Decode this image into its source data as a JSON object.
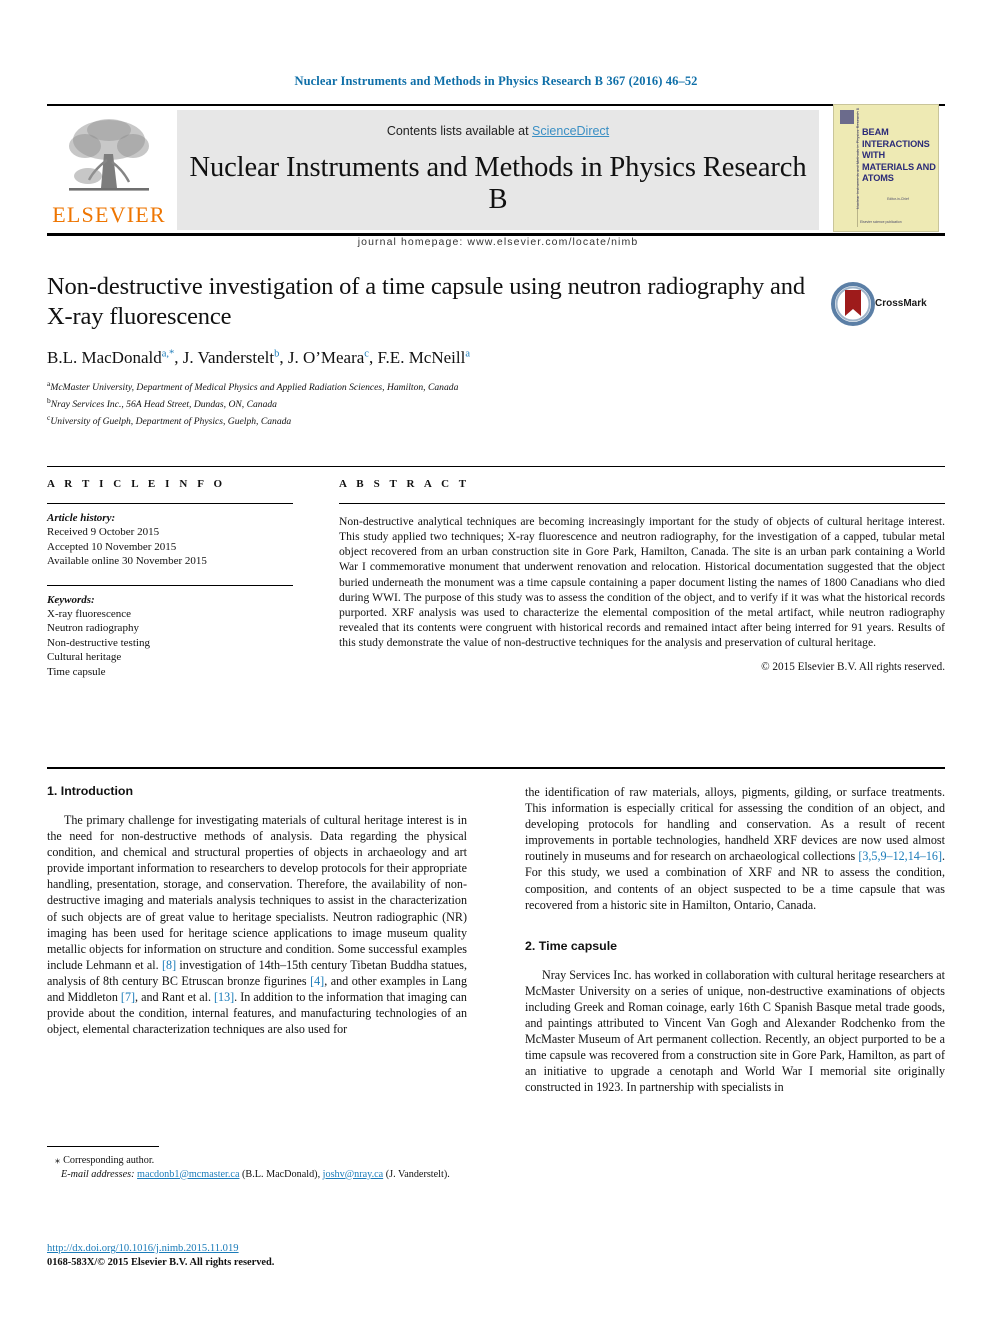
{
  "running_head": "Nuclear Instruments and Methods in Physics Research B 367 (2016) 46–52",
  "masthead": {
    "contents_prefix": "Contents lists available at ",
    "sciencedirect": "ScienceDirect",
    "journal_title": "Nuclear Instruments and Methods in Physics Research B",
    "homepage": "journal homepage: www.elsevier.com/locate/nimb",
    "publisher_logo_text": "ELSEVIER",
    "cover": {
      "heading": "BEAM INTERACTIONS WITH MATERIALS AND ATOMS",
      "spine": "Nuclear Instruments and Methods in Physics Research B",
      "subtitle": "Editor-in-Chief",
      "footer": "Elsevier science publication"
    },
    "colors": {
      "link": "#3a8fc4",
      "banner_bg": "#e7e7e7",
      "elsevier_orange": "#ee7501",
      "cover_bg": "#eeeab4",
      "cover_text": "#2b2b78"
    }
  },
  "article": {
    "title": "Non-destructive investigation of a time capsule using neutron radiography and X-ray fluorescence",
    "authors": [
      {
        "name": "B.L. MacDonald",
        "marks": "a,*"
      },
      {
        "name": "J. Vanderstelt",
        "marks": "b"
      },
      {
        "name": "J. O’Meara",
        "marks": "c"
      },
      {
        "name": "F.E. McNeill",
        "marks": "a"
      }
    ],
    "affiliations": [
      {
        "label": "a",
        "text": "McMaster University, Department of Medical Physics and Applied Radiation Sciences, Hamilton, Canada"
      },
      {
        "label": "b",
        "text": "Nray Services Inc., 56A Head Street, Dundas, ON, Canada"
      },
      {
        "label": "c",
        "text": "University of Guelph, Department of Physics, Guelph, Canada"
      }
    ],
    "crossmark_label": "CrossMark"
  },
  "article_info": {
    "heading": "A R T I C L E    I N F O",
    "history_label": "Article history:",
    "history": [
      "Received 9 October 2015",
      "Accepted 10 November 2015",
      "Available online 30 November 2015"
    ],
    "keywords_label": "Keywords:",
    "keywords": [
      "X-ray fluorescence",
      "Neutron radiography",
      "Non-destructive testing",
      "Cultural heritage",
      "Time capsule"
    ]
  },
  "abstract": {
    "heading": "A B S T R A C T",
    "text": "Non-destructive analytical techniques are becoming increasingly important for the study of objects of cultural heritage interest. This study applied two techniques; X-ray fluorescence and neutron radiography, for the investigation of a capped, tubular metal object recovered from an urban construction site in Gore Park, Hamilton, Canada. The site is an urban park containing a World War I commemorative monument that underwent renovation and relocation. Historical documentation suggested that the object buried underneath the monument was a time capsule containing a paper document listing the names of 1800 Canadians who died during WWI. The purpose of this study was to assess the condition of the object, and to verify if it was what the historical records purported. XRF analysis was used to characterize the elemental composition of the metal artifact, while neutron radiography revealed that its contents were congruent with historical records and remained intact after being interred for 91 years. Results of this study demonstrate the value of non-destructive techniques for the analysis and preservation of cultural heritage.",
    "copyright": "© 2015 Elsevier B.V. All rights reserved."
  },
  "sections": {
    "introduction_heading": "1. Introduction",
    "introduction_para_left_a": "The primary challenge for investigating materials of cultural heritage interest is in the need for non-destructive methods of analysis. Data regarding the physical condition, and chemical and structural properties of objects in archaeology and art provide important information to researchers to develop protocols for their appropriate handling, presentation, storage, and conservation. Therefore, the availability of non-destructive imaging and materials analysis techniques to assist in the characterization of such objects are of great value to heritage specialists. Neutron radiographic (NR) imaging has been used for heritage science applications to image museum quality metallic objects for information on structure and condition. Some successful examples include Lehmann et al. ",
    "ref_8": "[8]",
    "introduction_para_left_b": " investigation of 14th–15th century Tibetan Buddha statues, analysis of 8th century BC Etruscan bronze figurines ",
    "ref_4": "[4]",
    "introduction_para_left_c": ", and other examples in Lang and Middleton ",
    "ref_7": "[7]",
    "introduction_para_left_d": ", and Rant et al. ",
    "ref_13": "[13]",
    "introduction_para_left_e": ". In addition to the information that imaging can provide about the condition, internal features, and manufacturing technologies of an object, elemental characterization techniques are also used for",
    "introduction_para_right_a": "the identification of raw materials, alloys, pigments, gilding, or surface treatments. This information is especially critical for assessing the condition of an object, and developing protocols for handling and conservation. As a result of recent improvements in portable technologies, handheld XRF devices are now used almost routinely in museums and for research on archaeological collections ",
    "ref_group": "[3,5,9–12,14–16]",
    "introduction_para_right_b": ". For this study, we used a combination of XRF and NR to assess the condition, composition, and contents of an object suspected to be a time capsule that was recovered from a historic site in Hamilton, Ontario, Canada.",
    "time_capsule_heading": "2. Time capsule",
    "time_capsule_para": "Nray Services Inc. has worked in collaboration with cultural heritage researchers at McMaster University on a series of unique, non-destructive examinations of objects including Greek and Roman coinage, early 16th C Spanish Basque metal trade goods, and paintings attributed to Vincent Van Gogh and Alexander Rodchenko from the McMaster Museum of Art permanent collection. Recently, an object purported to be a time capsule was recovered from a construction site in Gore Park, Hamilton, as part of an initiative to upgrade a cenotaph and World War I memorial site originally constructed in 1923. In partnership with specialists in"
  },
  "footnotes": {
    "corresponding": "Corresponding author.",
    "email_label": "E-mail addresses:",
    "email_1": "macdonb1@mcmaster.ca",
    "email_1_owner": " (B.L. MacDonald), ",
    "email_2": "joshv@nray.ca",
    "email_2_owner": " (J. Vanderstelt)."
  },
  "footer": {
    "doi": "http://dx.doi.org/10.1016/j.nimb.2015.11.019",
    "issn": "0168-583X/© 2015 Elsevier B.V. All rights reserved."
  }
}
